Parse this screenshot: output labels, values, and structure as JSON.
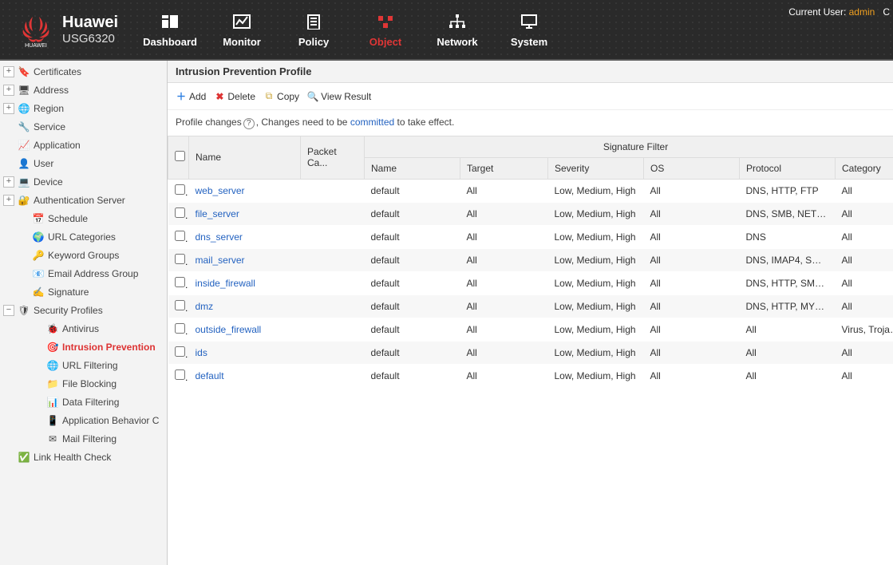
{
  "brand": {
    "name": "Huawei",
    "model": "USG6320",
    "logo_label": "HUAWEI"
  },
  "user": {
    "prefix": "Current User: ",
    "name": "admin",
    "suffix": "C"
  },
  "nav": [
    {
      "id": "dashboard",
      "label": "Dashboard",
      "active": false
    },
    {
      "id": "monitor",
      "label": "Monitor",
      "active": false
    },
    {
      "id": "policy",
      "label": "Policy",
      "active": false
    },
    {
      "id": "object",
      "label": "Object",
      "active": true
    },
    {
      "id": "network",
      "label": "Network",
      "active": false
    },
    {
      "id": "system",
      "label": "System",
      "active": false
    }
  ],
  "sidebar": [
    {
      "level": 0,
      "toggle": "+",
      "icon": "🔖",
      "label": "Certificates"
    },
    {
      "level": 0,
      "toggle": "+",
      "icon": "🖥",
      "label": "Address"
    },
    {
      "level": 0,
      "toggle": "+",
      "icon": "🌐",
      "label": "Region"
    },
    {
      "level": 0,
      "toggle": "",
      "icon": "🔧",
      "label": "Service"
    },
    {
      "level": 0,
      "toggle": "",
      "icon": "📈",
      "label": "Application"
    },
    {
      "level": 0,
      "toggle": "",
      "icon": "👤",
      "label": "User"
    },
    {
      "level": 0,
      "toggle": "+",
      "icon": "💻",
      "label": "Device"
    },
    {
      "level": 0,
      "toggle": "+",
      "icon": "🔐",
      "label": "Authentication Server"
    },
    {
      "level": 1,
      "toggle": "",
      "icon": "📅",
      "label": "Schedule"
    },
    {
      "level": 1,
      "toggle": "",
      "icon": "🌍",
      "label": "URL Categories"
    },
    {
      "level": 1,
      "toggle": "",
      "icon": "🔑",
      "label": "Keyword Groups"
    },
    {
      "level": 1,
      "toggle": "",
      "icon": "📧",
      "label": "Email Address Group"
    },
    {
      "level": 1,
      "toggle": "",
      "icon": "✍",
      "label": "Signature"
    },
    {
      "level": 0,
      "toggle": "−",
      "icon": "🛡",
      "label": "Security Profiles"
    },
    {
      "level": 2,
      "toggle": "",
      "icon": "🐞",
      "label": "Antivirus"
    },
    {
      "level": 2,
      "toggle": "",
      "icon": "🎯",
      "label": "Intrusion Prevention",
      "active": true
    },
    {
      "level": 2,
      "toggle": "",
      "icon": "🌐",
      "label": "URL Filtering"
    },
    {
      "level": 2,
      "toggle": "",
      "icon": "📁",
      "label": "File Blocking"
    },
    {
      "level": 2,
      "toggle": "",
      "icon": "📊",
      "label": "Data Filtering"
    },
    {
      "level": 2,
      "toggle": "",
      "icon": "📱",
      "label": "Application Behavior C"
    },
    {
      "level": 2,
      "toggle": "",
      "icon": "✉",
      "label": "Mail Filtering"
    },
    {
      "level": 0,
      "toggle": "",
      "icon": "✅",
      "label": "Link Health Check"
    }
  ],
  "page": {
    "title": "Intrusion Prevention Profile",
    "toolbar": {
      "add": "Add",
      "delete": "Delete",
      "copy": "Copy",
      "view": "View Result"
    },
    "note": {
      "part1": "Profile changes",
      "part2": ", Changes need to be ",
      "link": "committed",
      "part3": " to take effect."
    },
    "columns": {
      "name": "Name",
      "packet": "Packet Ca...",
      "filter_group": "Signature Filter",
      "sfname": "Name",
      "target": "Target",
      "severity": "Severity",
      "os": "OS",
      "protocol": "Protocol",
      "category": "Category"
    },
    "rows": [
      {
        "name": "web_server",
        "packet": "",
        "sfname": "default",
        "target": "All",
        "severity": "Low, Medium, High",
        "os": "All",
        "protocol": "DNS, HTTP, FTP",
        "category": "All"
      },
      {
        "name": "file_server",
        "packet": "",
        "sfname": "default",
        "target": "All",
        "severity": "Low, Medium, High",
        "os": "All",
        "protocol": "DNS, SMB, NETB...",
        "category": "All"
      },
      {
        "name": "dns_server",
        "packet": "",
        "sfname": "default",
        "target": "All",
        "severity": "Low, Medium, High",
        "os": "All",
        "protocol": "DNS",
        "category": "All"
      },
      {
        "name": "mail_server",
        "packet": "",
        "sfname": "default",
        "target": "All",
        "severity": "Low, Medium, High",
        "os": "All",
        "protocol": "DNS, IMAP4, SMT...",
        "category": "All"
      },
      {
        "name": "inside_firewall",
        "packet": "",
        "sfname": "default",
        "target": "All",
        "severity": "Low, Medium, High",
        "os": "All",
        "protocol": "DNS, HTTP, SMB,...",
        "category": "All"
      },
      {
        "name": "dmz",
        "packet": "",
        "sfname": "default",
        "target": "All",
        "severity": "Low, Medium, High",
        "os": "All",
        "protocol": "DNS, HTTP, MYS...",
        "category": "All"
      },
      {
        "name": "outside_firewall",
        "packet": "",
        "sfname": "default",
        "target": "All",
        "severity": "Low, Medium, High",
        "os": "All",
        "protocol": "All",
        "category": "Virus, Trojan, l"
      },
      {
        "name": "ids",
        "packet": "",
        "sfname": "default",
        "target": "All",
        "severity": "Low, Medium, High",
        "os": "All",
        "protocol": "All",
        "category": "All"
      },
      {
        "name": "default",
        "packet": "",
        "sfname": "default",
        "target": "All",
        "severity": "Low, Medium, High",
        "os": "All",
        "protocol": "All",
        "category": "All"
      }
    ]
  }
}
